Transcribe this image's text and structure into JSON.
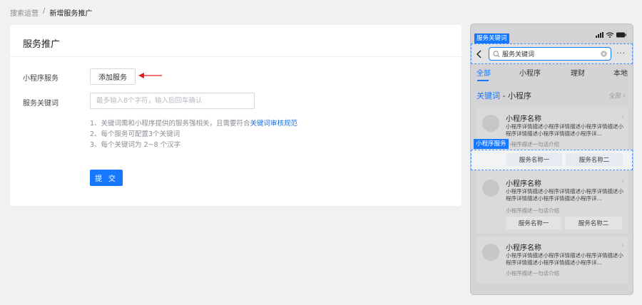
{
  "breadcrumb": {
    "parent": "搜索运营",
    "separator": "/",
    "current": "新增服务推广"
  },
  "form": {
    "title": "服务推广",
    "mini_program_label": "小程序服务",
    "add_service_button": "添加服务",
    "keyword_label": "服务关键词",
    "keyword_placeholder": "最多输入8个字符，输入后回车确认",
    "tip1_prefix": "1、关键词需和小程序提供的服务强相关，且需要符合",
    "tip1_link": "关键词审核规范",
    "tip2": "2、每个服务可配置3个关键词",
    "tip3": "3、每个关键词为 2~8 个汉字",
    "submit_button": "提 交",
    "arrow_color": "#e02020"
  },
  "phone": {
    "keyword_tag": "服务关键词",
    "service_tag": "小程序服务",
    "search_text": "服务关键词",
    "more": "···",
    "tabs": [
      "全部",
      "小程序",
      "理财",
      "本地"
    ],
    "active_tab": "全部",
    "section_title": "关键词",
    "section_sep": " - ",
    "section_sub": "小程序",
    "section_all": "全部",
    "cards": [
      {
        "name": "小程序名称",
        "desc": "小程序详情描述小程序详情描述小程序详情描述小程序详情描述小程序详情描述小程序详...",
        "intro": "小程序描述一句话介绍",
        "services": [
          "服务名称一",
          "服务名称二"
        ]
      },
      {
        "name": "小程序名称",
        "desc": "小程序详情描述小程序详情描述小程序详情描述小程序详情描述小程序详情描述小程序详...",
        "intro": "小程序描述一句话介绍",
        "services": [
          "服务名称一",
          "服务名称二"
        ]
      },
      {
        "name": "小程序名称",
        "desc": "小程序详情描述小程序详情描述小程序详情描述小程序详情描述小程序详情描述小程序详...",
        "intro": "小程序描述一句话介绍",
        "services": []
      }
    ],
    "accent_color": "#1677ff"
  }
}
